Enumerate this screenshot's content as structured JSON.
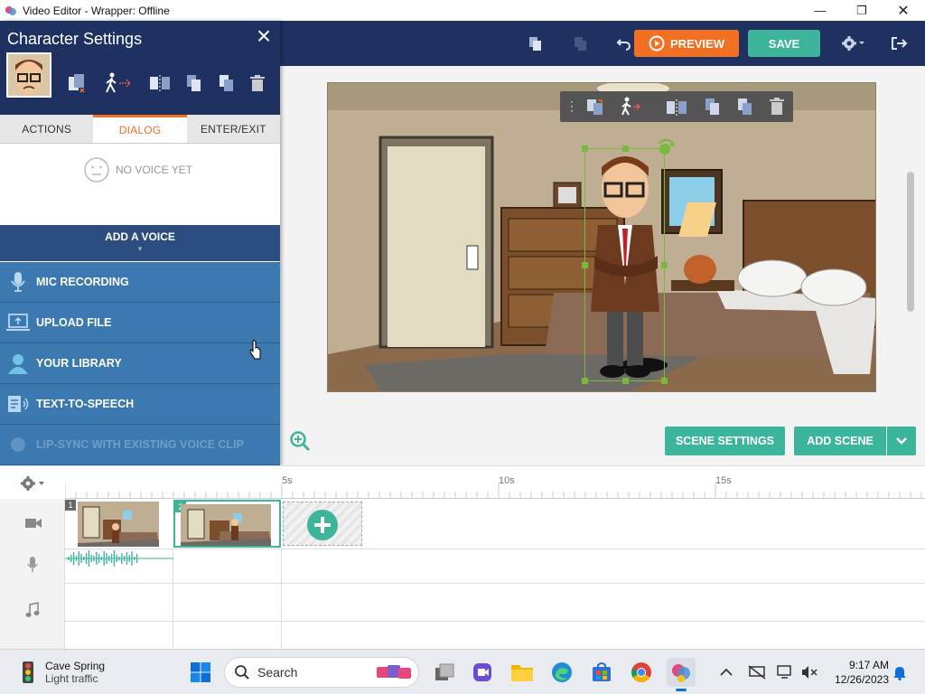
{
  "window": {
    "title": "Video Editor - Wrapper: Offline"
  },
  "toolbar": {
    "preview_label": "PREVIEW",
    "save_label": "SAVE"
  },
  "panel": {
    "title": "Character Settings",
    "tabs": [
      {
        "label": "ACTIONS"
      },
      {
        "label": "DIALOG"
      },
      {
        "label": "ENTER/EXIT"
      }
    ],
    "active_tab": "DIALOG",
    "no_voice": "NO VOICE YET",
    "add_voice": "ADD A VOICE",
    "voice_items": [
      {
        "label": "MIC RECORDING",
        "icon": "microphone-icon"
      },
      {
        "label": "UPLOAD FILE",
        "icon": "upload-icon"
      },
      {
        "label": "YOUR LIBRARY",
        "icon": "user-icon"
      },
      {
        "label": "TEXT-TO-SPEECH",
        "icon": "speech-icon"
      },
      {
        "label": "LIP-SYNC WITH EXISTING VOICE CLIP",
        "icon": "lipsync-icon"
      }
    ]
  },
  "stage_buttons": {
    "scene_settings": "SCENE SETTINGS",
    "add_scene": "ADD SCENE"
  },
  "timeline": {
    "ticks": [
      "5s",
      "10s",
      "15s"
    ],
    "scenes": [
      {
        "number": "1"
      },
      {
        "number": "2"
      }
    ]
  },
  "taskbar": {
    "weather_title": "Cave Spring",
    "weather_sub": "Light traffic",
    "search_placeholder": "Search",
    "time": "9:17 AM",
    "date": "12/26/2023"
  },
  "colors": {
    "header": "#1f3161",
    "accent_orange": "#f36f21",
    "accent_green": "#3cb59a",
    "voice_blue": "#3b79b0"
  }
}
